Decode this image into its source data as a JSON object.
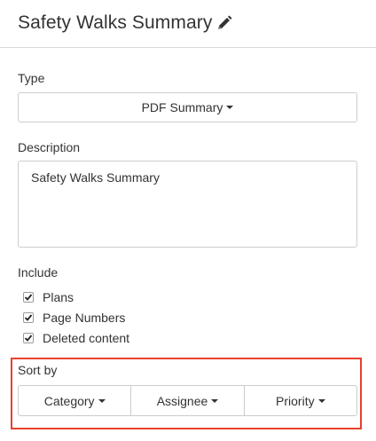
{
  "header": {
    "title": "Safety Walks Summary",
    "edit_icon": "pencil-icon"
  },
  "type": {
    "label": "Type",
    "selected": "PDF Summary"
  },
  "description": {
    "label": "Description",
    "value": "Safety Walks Summary"
  },
  "include": {
    "label": "Include",
    "options": [
      {
        "label": "Plans",
        "checked": true
      },
      {
        "label": "Page Numbers",
        "checked": true
      },
      {
        "label": "Deleted content",
        "checked": true
      }
    ]
  },
  "sort_by": {
    "label": "Sort by",
    "buttons": [
      "Category",
      "Assignee",
      "Priority"
    ],
    "highlight_color": "#e8412c"
  }
}
